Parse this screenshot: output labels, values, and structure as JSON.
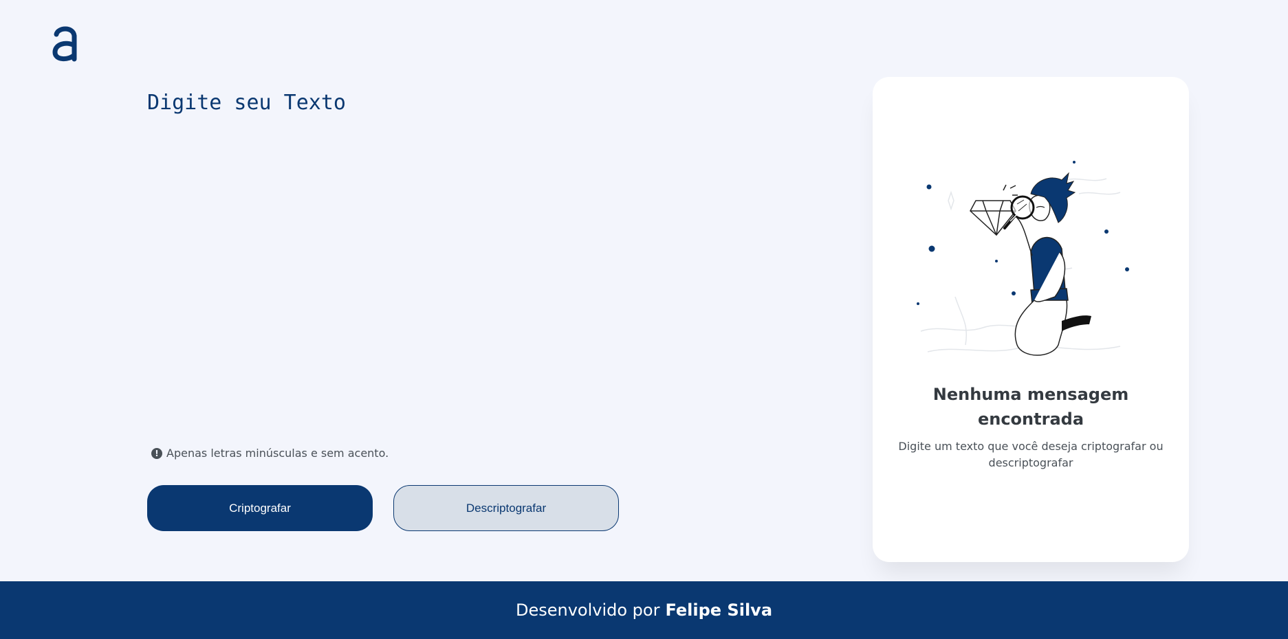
{
  "app": {
    "logo_letter": "a",
    "accent_color": "#0a3871",
    "background_color": "#f3f5fc"
  },
  "input": {
    "placeholder": "Digite seu Texto",
    "value": ""
  },
  "hint": {
    "icon": "exclamation-circle-icon",
    "text": "Apenas letras minúsculas e sem acento."
  },
  "buttons": {
    "encrypt_label": "Criptografar",
    "decrypt_label": "Descriptografar"
  },
  "output": {
    "illustration": "person-with-magnifier-diamond-illustration",
    "title": "Nenhuma mensagem encontrada",
    "text": "Digite um texto que você deseja criptografar ou descriptografar"
  },
  "footer": {
    "prefix": "Desenvolvido por",
    "author": "Felipe Silva"
  }
}
